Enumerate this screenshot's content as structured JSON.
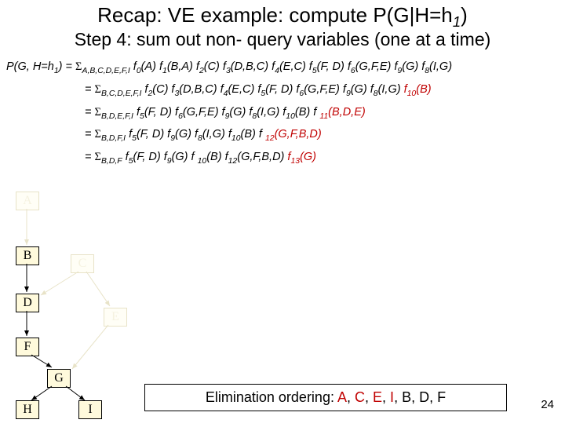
{
  "title_pre": "Recap: VE example: compute ",
  "title_expr_a": "P(G|H=h",
  "title_expr_b": ")",
  "subtitle": "Step 4: sum out non- query variables (one at a time)",
  "lhs": "P(G, H=h",
  "lhs_sub": "1",
  "lhs_tail": ") = ",
  "sum_label1": "A,B,C,D,E,F,I",
  "sum_label2": "B,C,D,E,F,I",
  "sum_label3": "B,D,E,F,I",
  "sum_label4": "B,D,F,I",
  "sum_label5": "B,D,F",
  "eq": "= ",
  "f0": "(A) f",
  "f0a": "0",
  "f1": "(B,A) f",
  "f1a": "1",
  "f2": "(C) f",
  "f2a": "2",
  "f3": "(D,B,C) f",
  "f3a": "3",
  "f4": "(E,C) f",
  "f4a": "4",
  "f5": "(F, D) f",
  "f5a": "5",
  "f6": "(G,F,E) f",
  "f6a": "6",
  "f9": "(G) f",
  "f9a": "9",
  "f8": "(I,G)",
  "f8a": "8",
  "f10": "(B)",
  "f10a": "10",
  "f10b": "(B) f",
  "f11": "(B,D,E)",
  "f11a": "11",
  "f12": "(G,F,B,D)",
  "f12a": "12",
  "f13": "(G)",
  "f13a": "13",
  "nodes": {
    "A": "A",
    "B": "B",
    "C": "C",
    "D": "D",
    "E": "E",
    "F": "F",
    "G": "G",
    "H": "H",
    "I": "I"
  },
  "elim_prefix": "Elimination ordering: ",
  "elim": {
    "A": "A",
    "C": "C",
    "E": "E",
    "I": "I",
    "B": "B",
    "D": "D",
    "F": "F"
  },
  "slidenum": "24"
}
